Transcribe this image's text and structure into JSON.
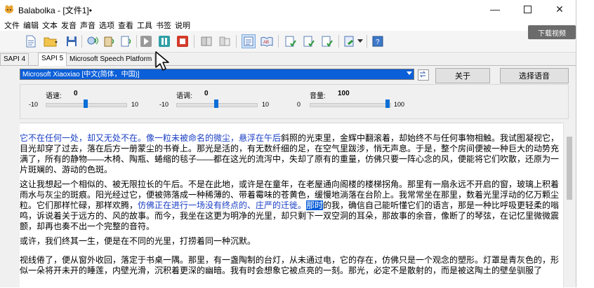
{
  "window": {
    "title": "Balabolka - [文件1]•"
  },
  "menu": [
    "文件",
    "编辑",
    "文本",
    "发音",
    "声音",
    "选项",
    "查看",
    "工具",
    "书签",
    "说明"
  ],
  "tabs": [
    "SAPI 4",
    "SAPI 5",
    "Microsoft Speech Platform"
  ],
  "active_tab": 1,
  "voice": {
    "selected": "Microsoft Xiaoxiao [中文(简体，中国)]",
    "about_label": "关于",
    "select_label": "选择语音"
  },
  "sliders": {
    "rate": {
      "label": "语速:",
      "value": "0",
      "min": "-10",
      "max": "10",
      "fraction": 0.5
    },
    "pitch": {
      "label": "语调:",
      "value": "0",
      "min": "-10",
      "max": "10",
      "fraction": 0.5
    },
    "volume": {
      "label": "音量:",
      "value": "100",
      "min": "0",
      "max": "100",
      "fraction": 1.0
    }
  },
  "overlay_button": "下载视频",
  "text": {
    "p1_blue": "它不在任何一处，却又无处不在。像一粒未被命名的微尘，悬浮在午后",
    "p1_rest": "斜照的光束里，金辉中翻滚着，却始终不与任何事物相触。我试图凝视它，目光却穿了过去，落在后方一册蒙尘的书脊上。那光是活的，有无数纤细的足，在空气里跋涉，悄无声息。于是，整个房间便被一种巨大的动势充满了，所有的静物——木椅、陶瓶、蜷缩的毯子——都在这光的流泻中，失却了原有的重量，仿佛只要一阵心念的风，便能将它们吹散，还原为一片斑斓的、游动的色斑。",
    "p2_a": "这让我想起一个相似的、被无限拉长的午后。不是在此地，或许是在童年，在老屋通向阁楼的楼梯拐角。那里有一扇永远不开启的窗，玻璃上积着雨水与灰尘的斑痕。阳光经过它，便被筛落成一种稀薄的、带着霉味的苍黄色，缓慢地淌落在台阶上。我常常坐在那里，数着光里浮动的亿万颗尘粒。它们那样忙碌，那样欢腾，",
    "p2_blue": "仿佛正在进行一场没有终点的、庄严的迁徙。",
    "p2_hl": "那时",
    "p2_b": "的我，确信自己能听懂它们的语言，那是一种比呼吸更轻柔的嗡鸣，诉说着关于远方的、风的故事。而今，我坐在这更为明净的光里，却只剩下一双空洞的耳朵，那故事的余音，像断了的琴弦，在记忆里微微震颤，却再也奏不出一个完整的音符。",
    "p3": "或许，我们终其一生，便是在不同的光里，打捞着同一种沉默。",
    "p4": "视线倦了，便从窗外收回，落定于书桌一隅。那里，有一盏陶制的台灯，从未通过电，它的存在，仿佛只是一个观念的塑形。灯罩是青灰色的，形似一朵将开未开的睡莲，内壁光滑，沉积着更深的幽暗。我有时会想象它被点亮的一刻。那光，必定不是散射的，而是被这陶土的壁垒驯服了"
  }
}
